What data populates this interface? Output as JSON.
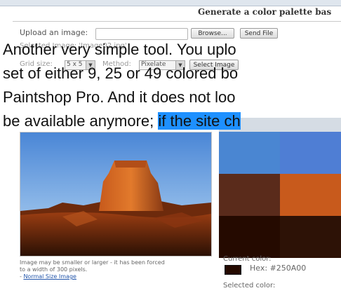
{
  "header": {
    "title": "Generate a color palette bas"
  },
  "upload": {
    "label": "Upload an image:",
    "browse_label": "Browse...",
    "send_label": "Send File"
  },
  "faint_row": {
    "left_text": "Selected Image: 'Image02.jpg'"
  },
  "options": {
    "grid_label": "Grid size:",
    "grid_value": "5 x 5",
    "method_label": "Method:",
    "method_value": "Pixelate",
    "select_label": "Select Image"
  },
  "overlay": {
    "line1": "Another very simple tool. You uplo",
    "line2": "set of either 9, 25 or 49 colored bo",
    "line3": "Paintshop Pro. And it does not loo",
    "line4_plain": "be available anymore; ",
    "line4_highlight": "if the site ch"
  },
  "image_note": {
    "line1": "Image may be smaller or larger - it has been forced",
    "line2": "to a width of 300 pixels.",
    "link": "Normal Size Image",
    "link_prefix": "- "
  },
  "palette": {
    "colors": [
      "#4a86d2",
      "#4f7ed4",
      "#5a2b1b",
      "#c85a1c",
      "#250a00",
      "#2d1206"
    ]
  },
  "color_info": {
    "current_label": "Current color:",
    "hex_label": "Hex:",
    "hex_value": "#250A00",
    "current_color": "#250A00",
    "selected_label": "Selected color:"
  }
}
